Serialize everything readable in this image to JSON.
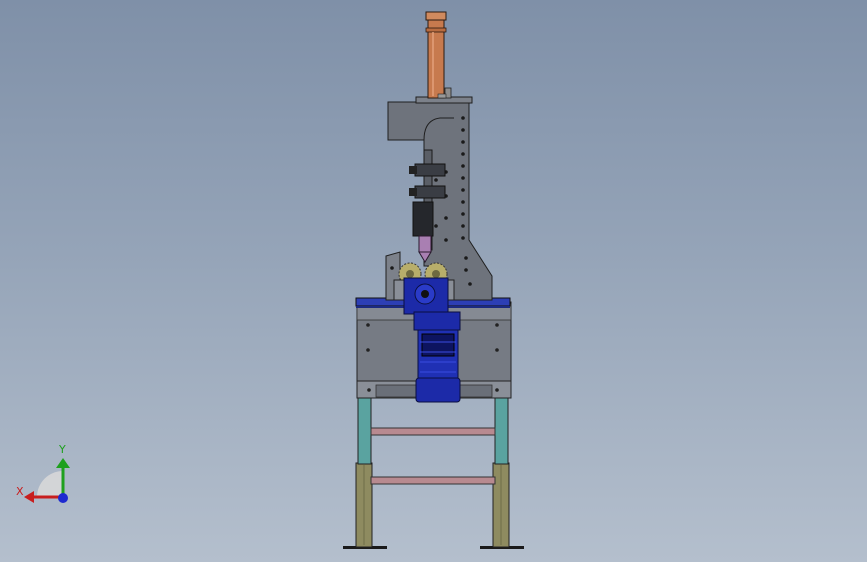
{
  "viewport": {
    "background_top": "#7f90a8",
    "background_bottom": "#b4bfcd"
  },
  "triad": {
    "x_label": "X",
    "y_label": "Y",
    "x_color": "#c81e1e",
    "y_color": "#1ea01e",
    "z_color": "#1e2ad0"
  },
  "model": {
    "parts": [
      "frame",
      "c-frame",
      "cylinder",
      "tooling",
      "gears",
      "motor"
    ],
    "colors": {
      "frame_steel": "#6e737c",
      "cylinder": "#c77a4e",
      "motor": "#1c2aa8",
      "top_plate": "#2d3fb5",
      "legs_upper": "#5aa3a0",
      "legs_lower": "#8e8b60",
      "cross_bars": "#b88a90"
    }
  }
}
